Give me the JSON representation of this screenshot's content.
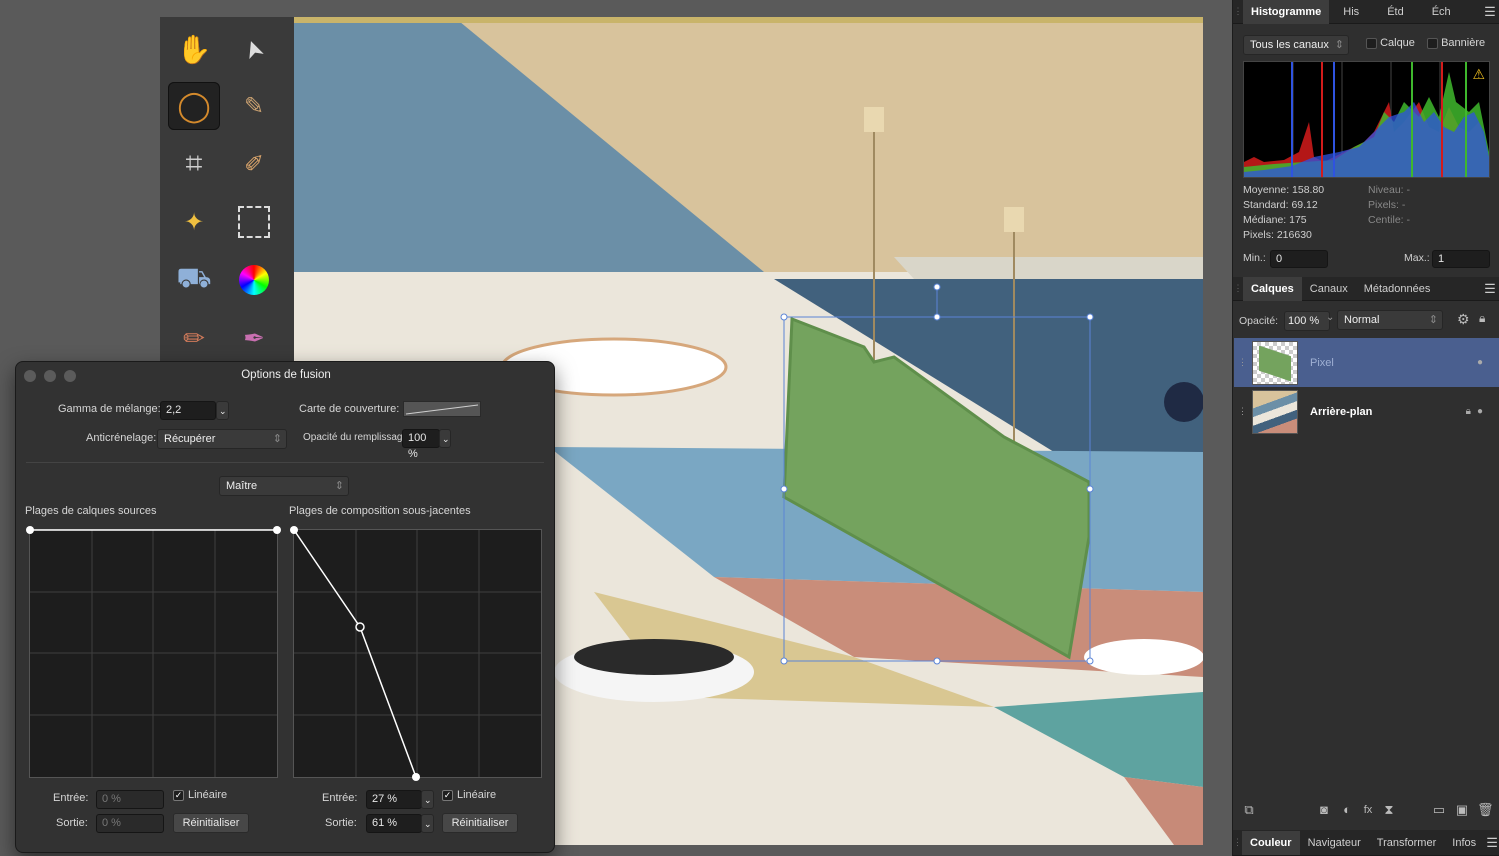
{
  "tools": [
    {
      "name": "hand-tool-icon",
      "glyph": "✋"
    },
    {
      "name": "move-tool-icon",
      "glyph": "➤"
    },
    {
      "name": "lasso-tool-icon",
      "glyph": "◯"
    },
    {
      "name": "color-picker-icon",
      "glyph": "✎"
    },
    {
      "name": "crop-tool-icon",
      "glyph": "⌗"
    },
    {
      "name": "paint-brush-icon",
      "glyph": "✐"
    },
    {
      "name": "magic-wand-icon",
      "glyph": "✦"
    },
    {
      "name": "marquee-tool-icon",
      "glyph": "⬚"
    },
    {
      "name": "fill-tool-icon",
      "glyph": "⛟"
    },
    {
      "name": "color-wheel-icon",
      "glyph": "◉"
    },
    {
      "name": "brush-tool-icon",
      "glyph": "✏"
    },
    {
      "name": "selection-brush-icon",
      "glyph": "✒"
    }
  ],
  "histogram": {
    "tabs": [
      "Histogramme",
      "His",
      "Étd",
      "Éch"
    ],
    "channel": "Tous les canaux",
    "layer_label": "Calque",
    "banner_label": "Bannière",
    "stats": {
      "mean": "Moyenne: 158.80",
      "std": "Standard: 69.12",
      "median": "Médiane: 175",
      "pixels": "Pixels: 216630",
      "level": "Niveau: -",
      "pixels2": "Pixels: -",
      "centile": "Centile: -"
    },
    "min_label": "Min.:",
    "min_value": "0",
    "max_label": "Max.:",
    "max_value": "1"
  },
  "layers_panel": {
    "tabs": [
      "Calques",
      "Canaux",
      "Métadonnées"
    ],
    "opacity_label": "Opacité:",
    "opacity_value": "100 %",
    "blend_mode": "Normal",
    "layers": [
      {
        "name": "Pixel"
      },
      {
        "name": "Arrière-plan"
      }
    ]
  },
  "bottom_tabs": [
    "Couleur",
    "Navigateur",
    "Transformer",
    "Infos"
  ],
  "dialog": {
    "title": "Options de fusion",
    "gamma_label": "Gamma de mélange:",
    "gamma_value": "2,2",
    "coverage_label": "Carte de couverture:",
    "antialias_label": "Anticrénelage:",
    "antialias_value": "Récupérer",
    "fill_opacity_label": "Opacité du remplissage:",
    "fill_opacity_value": "100 %",
    "channel_value": "Maître",
    "source_label": "Plages de calques sources",
    "underlying_label": "Plages de composition sous-jacentes",
    "left": {
      "input_label": "Entrée:",
      "input_value": "0 %",
      "output_label": "Sortie:",
      "output_value": "0 %",
      "linear_label": "Linéaire",
      "reset_label": "Réinitialiser"
    },
    "right": {
      "input_label": "Entrée:",
      "input_value": "27 %",
      "output_label": "Sortie:",
      "output_value": "61 %",
      "linear_label": "Linéaire",
      "reset_label": "Réinitialiser"
    }
  },
  "colors": {
    "accent": "#4a6cb3",
    "selection": "#5b84d6",
    "layer_fill": "#74a35e"
  }
}
